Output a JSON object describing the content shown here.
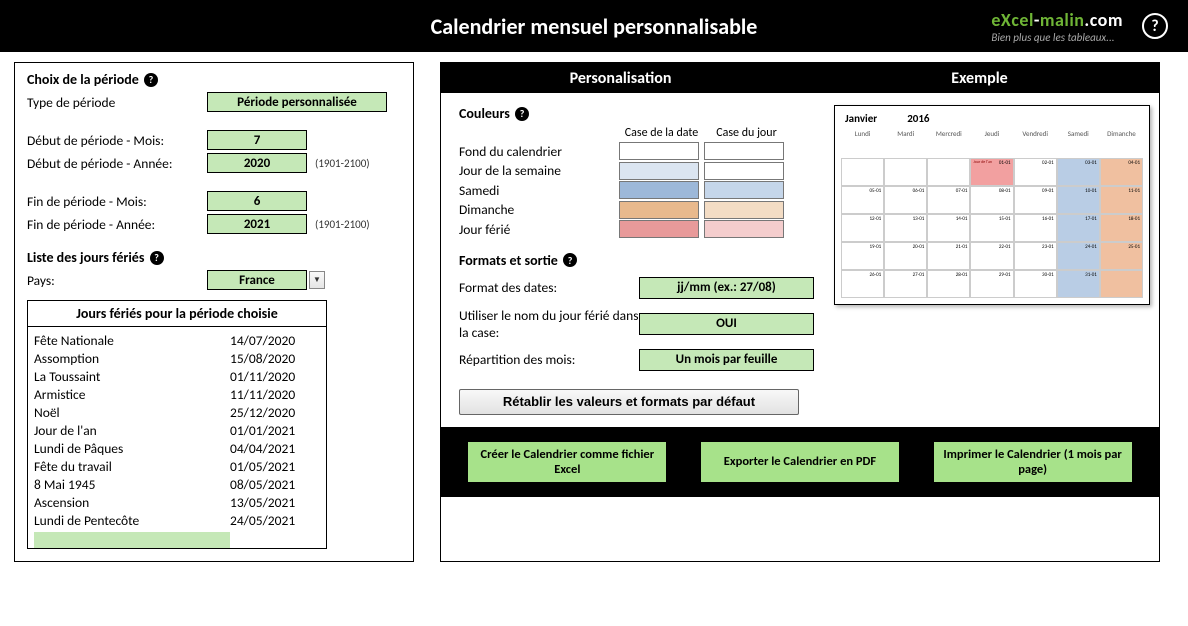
{
  "header": {
    "title": "Calendrier mensuel personnalisable",
    "brand_top_a": "eXcel",
    "brand_top_b": "-",
    "brand_top_c": "malin",
    "brand_top_d": ".com",
    "brand_sub": "Bien plus que les tableaux..."
  },
  "period": {
    "section": "Choix de la période",
    "type_label": "Type de période",
    "type_value": "Période personnalisée",
    "start_month_label": "Début de période - Mois:",
    "start_month": "7",
    "start_year_label": "Début de période - Année:",
    "start_year": "2020",
    "end_month_label": "Fin de période - Mois:",
    "end_month": "6",
    "end_year_label": "Fin de période - Année:",
    "end_year": "2021",
    "year_hint": "(1901-2100)"
  },
  "holidays": {
    "section": "Liste des jours fériés",
    "country_label": "Pays:",
    "country": "France",
    "list_title": "Jours fériés pour la période choisie",
    "items": [
      {
        "name": "Fête Nationale",
        "date": "14/07/2020"
      },
      {
        "name": "Assomption",
        "date": "15/08/2020"
      },
      {
        "name": "La Toussaint",
        "date": "01/11/2020"
      },
      {
        "name": "Armistice",
        "date": "11/11/2020"
      },
      {
        "name": "Noël",
        "date": "25/12/2020"
      },
      {
        "name": "Jour de l'an",
        "date": "01/01/2021"
      },
      {
        "name": "Lundi de Pâques",
        "date": "04/04/2021"
      },
      {
        "name": "Fête du travail",
        "date": "01/05/2021"
      },
      {
        "name": "8 Mai 1945",
        "date": "08/05/2021"
      },
      {
        "name": "Ascension",
        "date": "13/05/2021"
      },
      {
        "name": "Lundi de Pentecôte",
        "date": "24/05/2021"
      }
    ]
  },
  "tabs": {
    "personalisation": "Personalisation",
    "exemple": "Exemple"
  },
  "colors": {
    "section": "Couleurs",
    "col1": "Case de la date",
    "col2": "Case du jour",
    "rows": [
      {
        "label": "Fond du calendrier",
        "c1": "#ffffff",
        "c2": "#ffffff"
      },
      {
        "label": "Jour de la semaine",
        "c1": "#dbe5f1",
        "c2": "#ffffff"
      },
      {
        "label": "Samedi",
        "c1": "#9db8d9",
        "c2": "#c5d6ea"
      },
      {
        "label": "Dimanche",
        "c1": "#e8b98d",
        "c2": "#f3dcc4"
      },
      {
        "label": "Jour férié",
        "c1": "#e89a9a",
        "c2": "#f4cdcd"
      }
    ]
  },
  "formats": {
    "section": "Formats et sortie",
    "date_format_label": "Format des dates:",
    "date_format": "jj/mm (ex.: 27/08)",
    "use_name_label": "Utiliser le nom du jour férié dans la case:",
    "use_name": "OUI",
    "split_label": "Répartition des mois:",
    "split": "Un mois par feuille"
  },
  "restore_btn": "Rétablir les valeurs et formats par défaut",
  "example": {
    "month": "Janvier",
    "year": "2016",
    "days": [
      "Lundi",
      "Mardi",
      "Mercredi",
      "Jeudi",
      "Vendredi",
      "Samedi",
      "Dimanche"
    ],
    "ferie_label": "Jour de l'an"
  },
  "actions": {
    "create": "Créer le Calendrier comme fichier Excel",
    "export": "Exporter le Calendrier en PDF",
    "print": "Imprimer le Calendrier (1 mois par page)"
  }
}
